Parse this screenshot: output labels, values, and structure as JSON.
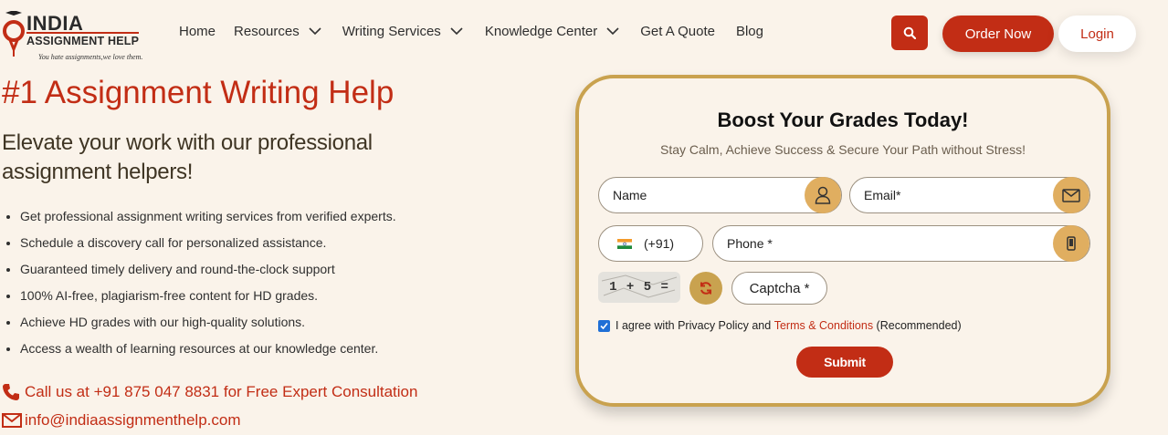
{
  "brand": {
    "line1": "INDIA",
    "line2": "ASSIGNMENT HELP",
    "tagline": "You hate assignments,we love them."
  },
  "nav": {
    "home": "Home",
    "resources": "Resources",
    "writing_services": "Writing Services",
    "knowledge_center": "Knowledge Center",
    "get_quote": "Get A Quote",
    "blog": "Blog"
  },
  "header": {
    "order_label": "Order Now",
    "login_label": "Login"
  },
  "hero": {
    "title": "#1 Assignment Writing Help",
    "subtitle": "Elevate your work with our professional assignment helpers!",
    "bullets": [
      "Get professional assignment writing services from verified experts.",
      "Schedule a discovery call for personalized assistance.",
      "Guaranteed timely delivery and round-the-clock support",
      "100% AI-free, plagiarism-free content for HD grades.",
      "Achieve HD grades with our high-quality solutions.",
      "Access a wealth of learning resources at our knowledge center."
    ],
    "phone_text": "Call us at +91 875 047 8831 for Free Expert Consultation",
    "email_text": "info@indiaassignmenthelp.com"
  },
  "form": {
    "title": "Boost Your Grades Today!",
    "subtitle": "Stay Calm, Achieve Success & Secure Your Path without Stress!",
    "name_placeholder": "Name",
    "email_placeholder": "Email*",
    "country_code": "(+91)",
    "phone_placeholder": "Phone *",
    "captcha_text": "1 + 5 =",
    "captcha_placeholder": "Captcha *",
    "agree_prefix": "I agree with Privacy Policy and ",
    "agree_terms": "Terms & Conditions",
    "agree_suffix": " (Recommended)",
    "agree_checked": true,
    "submit_label": "Submit"
  },
  "icons": {
    "search": "search-icon",
    "user": "user-icon",
    "mail": "mail-icon",
    "mobile": "mobile-icon",
    "refresh": "refresh-icon",
    "phone": "phone-icon",
    "india_flag": "india-flag-icon"
  },
  "colors": {
    "accent": "#c22d15",
    "gold": "#c9a24f",
    "icon_fill": "#e0ae60",
    "background": "#faf3ea"
  }
}
